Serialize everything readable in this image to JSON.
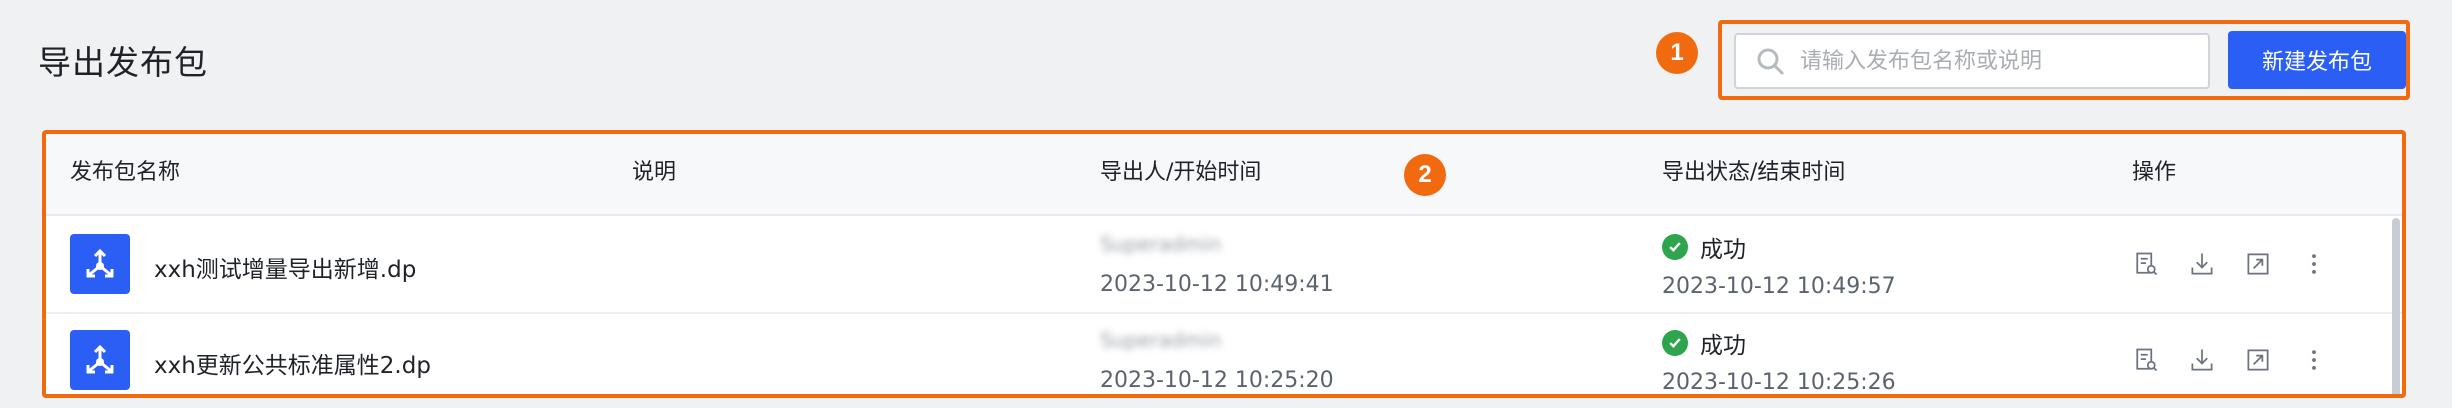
{
  "page": {
    "title": "导出发布包"
  },
  "markers": [
    "1",
    "2"
  ],
  "search": {
    "placeholder": "请输入发布包名称或说明",
    "value": ""
  },
  "toolbar": {
    "new_button_label": "新建发布包"
  },
  "table": {
    "columns": [
      "发布包名称",
      "说明",
      "导出人/开始时间",
      "导出状态/结束时间",
      "操作"
    ],
    "rows": [
      {
        "name": "xxh测试增量导出新增.dp",
        "description": "",
        "exporter": "Superadmin",
        "start_time": "2023-10-12 10:49:41",
        "status": "成功",
        "end_time": "2023-10-12 10:49:57"
      },
      {
        "name": "xxh更新公共标准属性2.dp",
        "description": "",
        "exporter": "Superadmin",
        "start_time": "2023-10-12 10:25:20",
        "status": "成功",
        "end_time": "2023-10-12 10:25:26"
      }
    ],
    "actions": [
      "view-log-icon",
      "download-icon",
      "export-icon",
      "more-icon"
    ]
  },
  "colors": {
    "accent": "#2b5ef5",
    "highlight": "#f26a10",
    "success": "#2ea44f",
    "background": "#f0f1f3"
  }
}
